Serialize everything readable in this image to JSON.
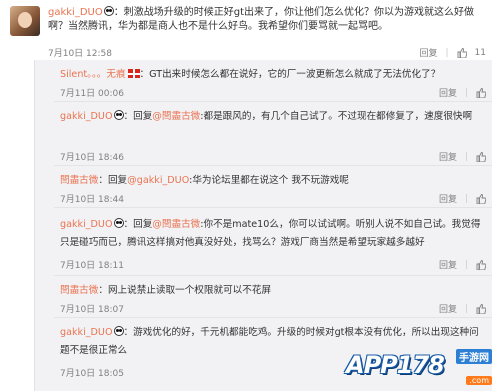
{
  "top_comment": {
    "user": "gakki_DUO",
    "text": "：刺激战场升级的时候正好gt出来了，你让他们怎么优化？你以为游戏就这么好做啊？当然腾讯，华为都是商人也不是什么好鸟。我希望你们要骂就一起骂吧。",
    "time": "7月10日 12:58",
    "reply_label": "回复",
    "like_count": "11"
  },
  "replies": [
    {
      "user": "Silent。。。无痕",
      "text": "：GT出来时候怎么都在说好，它的厂一波更新怎么就成了无法优化了？",
      "time": "7月11日 00:06",
      "reply_label": "回复"
    },
    {
      "user": "gakki_DUO",
      "text_prefix": "：回复",
      "mention": "@閆盡古微",
      "text": ":都是跟风的，有几个自己试了。不过现在都修复了，速度很快啊",
      "time": "7月10日 18:46",
      "reply_label": "回复"
    },
    {
      "user": "閆盡古微",
      "text_prefix": "：回复",
      "mention": "@gakki_DUO",
      "text": ":华为论坛里都在说这个  我不玩游戏呢",
      "time": "7月10日 18:44",
      "reply_label": "回复"
    },
    {
      "user": "gakki_DUO",
      "text_prefix": "：回复",
      "mention": "@閆盡古微",
      "text": ":你不是mate10么，你可以试试啊。听别人说不如自己试。我觉得只是碰巧而已，腾讯这样搞对他真没好处，找骂么？游戏厂商当然是希望玩家越多越好",
      "time": "7月10日 18:11",
      "reply_label": "回复"
    },
    {
      "user": "閆盡古微",
      "text": "：网上说禁止读取一个权限就可以不花屏",
      "time": "7月10日 18:07",
      "reply_label": "回复"
    },
    {
      "user": "gakki_DUO",
      "text": "：游戏优化的好，千元机都能吃鸡。升级的时候对gt根本没有优化，所以出现这种问题不是很正常么",
      "time": "7月10日 18:05",
      "reply_label": ""
    }
  ],
  "watermark": {
    "brand": "APP178",
    "sub": "手游网",
    "url": ".com"
  },
  "icons": {
    "like": "thumb-up-icon",
    "flag": "england-flag-icon",
    "panda": "panda-emoji-icon"
  }
}
